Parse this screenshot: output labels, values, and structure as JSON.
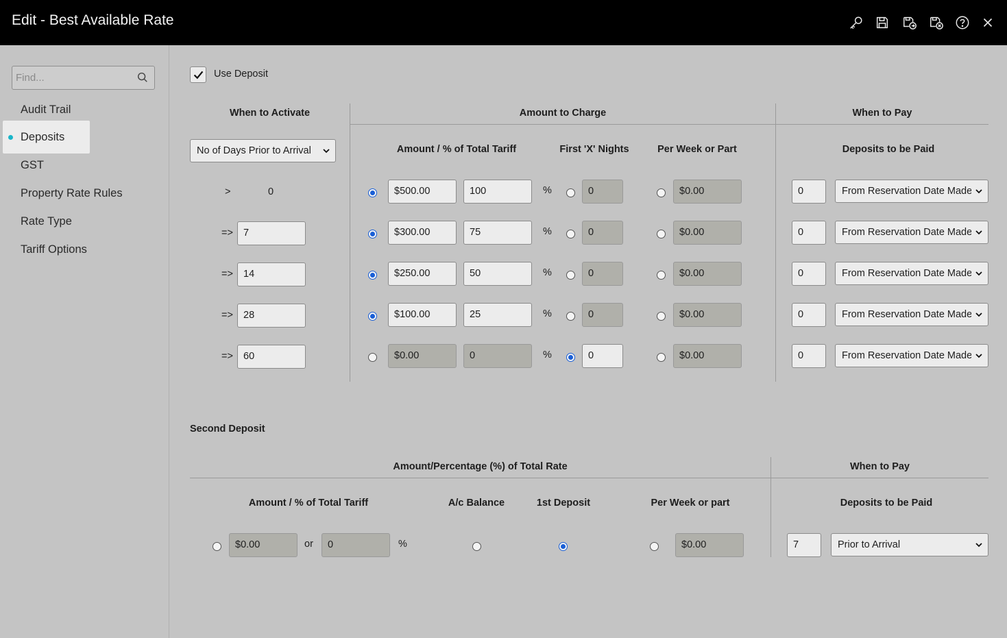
{
  "window": {
    "title": "Edit - Best Available Rate"
  },
  "toolbar_icons": [
    "key-icon",
    "save-icon",
    "save-and-close-icon",
    "save-and-exit-icon",
    "help-icon",
    "close-icon"
  ],
  "sidebar": {
    "search_placeholder": "Find...",
    "items": [
      {
        "label": "Audit Trail"
      },
      {
        "label": "Deposits",
        "active": true
      },
      {
        "label": "GST"
      },
      {
        "label": "Property Rate Rules"
      },
      {
        "label": "Rate Type"
      },
      {
        "label": "Tariff Options"
      }
    ]
  },
  "deposit": {
    "use_deposit_label": "Use Deposit",
    "use_deposit_checked": true,
    "headers": {
      "when_to_activate": "When to Activate",
      "amount_to_charge": "Amount to Charge",
      "when_to_pay": "When to Pay",
      "amount_pct": "Amount / % of Total Tariff",
      "first_x_nights": "First 'X' Nights",
      "per_week": "Per Week or Part",
      "deposits_to_be_paid": "Deposits to be Paid"
    },
    "activate_select": "No of Days Prior to Arrival",
    "percent_symbol": "%",
    "rows": [
      {
        "op": ">",
        "days": "0",
        "amount": "$500.00",
        "percent": "100",
        "nights": "0",
        "per_week": "$0.00",
        "pay_days": "0",
        "pay_when": "From Reservation Date Made"
      },
      {
        "op": "=>",
        "days": "7",
        "amount": "$300.00",
        "percent": "75",
        "nights": "0",
        "per_week": "$0.00",
        "pay_days": "0",
        "pay_when": "From Reservation Date Made"
      },
      {
        "op": "=>",
        "days": "14",
        "amount": "$250.00",
        "percent": "50",
        "nights": "0",
        "per_week": "$0.00",
        "pay_days": "0",
        "pay_when": "From Reservation Date Made"
      },
      {
        "op": "=>",
        "days": "28",
        "amount": "$100.00",
        "percent": "25",
        "nights": "0",
        "per_week": "$0.00",
        "pay_days": "0",
        "pay_when": "From Reservation Date Made"
      },
      {
        "op": "=>",
        "days": "60",
        "amount": "$0.00",
        "percent": "0",
        "nights": "0",
        "per_week": "$0.00",
        "pay_days": "0",
        "pay_when": "From Reservation Date Made"
      }
    ]
  },
  "second_deposit": {
    "title": "Second Deposit",
    "headers": {
      "amount_pct_total_rate": "Amount/Percentage (%) of Total Rate",
      "when_to_pay": "When to Pay",
      "amount_pct": "Amount / % of Total Tariff",
      "ac_balance": "A/c Balance",
      "first_deposit": "1st Deposit",
      "per_week": "Per Week or part",
      "deposits_to_be_paid": "Deposits to be Paid"
    },
    "amount": "$0.00",
    "or_label": "or",
    "percent": "0",
    "percent_symbol": "%",
    "per_week": "$0.00",
    "pay_days": "7",
    "pay_when": "Prior to Arrival"
  },
  "colors": {
    "titlebar": "#000000",
    "background": "#c4c4c4",
    "accent": "#18b5c9",
    "radio_selected": "#1a5fd6"
  }
}
